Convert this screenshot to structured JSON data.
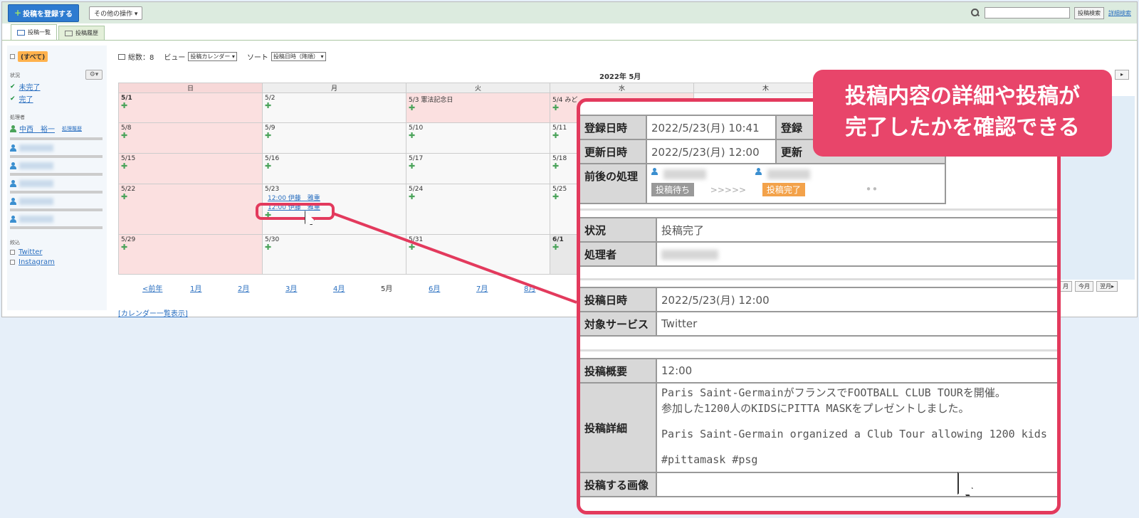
{
  "topbar": {
    "register_label": "投稿を登録する",
    "ops_label": "その他の操作 ▾",
    "search_button": "投稿検索",
    "advanced_link": "詳細検索"
  },
  "tabs": [
    {
      "label": "投稿一覧"
    },
    {
      "label": "投稿履歴"
    }
  ],
  "sidebar": {
    "all_label": "(すべて)",
    "status_title": "状況",
    "status_items": [
      "未完了",
      "完了"
    ],
    "assignee_title": "処理者",
    "assignee_name": "中西　裕一",
    "history_link": "処理履歴",
    "service_title": "絞込",
    "services": [
      "Twitter",
      "Instagram"
    ]
  },
  "main": {
    "total_label": "総数：8",
    "view_label": "ビュー",
    "view_value": "投稿カレンダー",
    "sort_label": "ソート",
    "sort_value": "投稿日時（降順）",
    "month_title": "2022年 5月",
    "weekdays": [
      "日",
      "月",
      "火",
      "水",
      "木"
    ],
    "weeks": [
      [
        "5/1",
        "5/2",
        "5/3 憲法記念日",
        "5/4 みど",
        ""
      ],
      [
        "5/8",
        "5/9",
        "5/10",
        "5/11",
        ""
      ],
      [
        "5/15",
        "5/16",
        "5/17",
        "5/18",
        ""
      ],
      [
        "5/22",
        "5/23",
        "5/24",
        "5/25",
        ""
      ],
      [
        "5/29",
        "5/30",
        "5/31",
        "6/1",
        ""
      ]
    ],
    "events": [
      "12:00 伊藤　雅重",
      "12:00 伊藤　雅重"
    ],
    "month_nav": [
      "<前年",
      "1月",
      "2月",
      "3月",
      "4月",
      "5月",
      "6月",
      "7月",
      "8月"
    ],
    "right_nav": [
      "月",
      "今月",
      "翌月▸"
    ],
    "calendar_list_link": "[カレンダー一覧表示]"
  },
  "detail": {
    "registered_label": "登録日時",
    "registered_value": "2022/5/23(月) 10:41",
    "registrant_label": "登録",
    "updated_label": "更新日時",
    "updated_value": "2022/5/23(月) 12:00",
    "updater_label": "更新",
    "flow_label": "前後の処理",
    "flow_prev": "投稿待ち",
    "flow_arrows": ">>>>>",
    "flow_next": "投稿完了",
    "status_label": "状況",
    "status_value": "投稿完了",
    "assignee_label": "処理者",
    "post_datetime_label": "投稿日時",
    "post_datetime_value": "2022/5/23(月) 12:00",
    "service_label": "対象サービス",
    "service_value": "Twitter",
    "summary_label": "投稿概要",
    "summary_value": "12:00",
    "body_label": "投稿詳細",
    "body_line1": "Paris Saint-GermainがフランスでFOOTBALL CLUB TOURを開催。",
    "body_line2": "参加した1200人のKIDSにPITTA MASKをプレゼントしました。",
    "body_line3": "Paris Saint-Germain organized a Club Tour allowing 1200 kids",
    "body_line4": "#pittamask #psg",
    "image_label": "投稿する画像"
  },
  "callout": {
    "line1": "投稿内容の詳細や投稿が",
    "line2": "完了したかを確認できる"
  },
  "colors": {
    "accent": "#e33a5d",
    "callout_bg": "#e8456a",
    "register_button": "#2d7bd0"
  }
}
